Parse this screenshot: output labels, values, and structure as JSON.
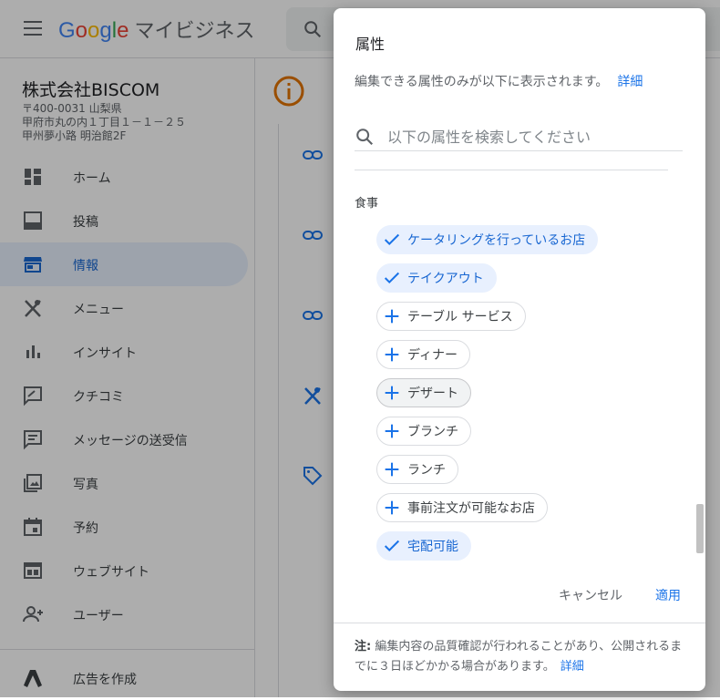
{
  "app": {
    "logo_google": "Google",
    "logo_product": "マイビジネス"
  },
  "business": {
    "name": "株式会社BISCOM",
    "address_line1": "〒400-0031 山梨県",
    "address_line2": "甲府市丸の内１丁目１－１－２５",
    "address_line3": "甲州夢小路 明治館2F"
  },
  "sidebar": {
    "items": [
      {
        "label": "ホーム",
        "icon": "dashboard-icon"
      },
      {
        "label": "投稿",
        "icon": "post-icon"
      },
      {
        "label": "情報",
        "icon": "storefront-icon",
        "active": true
      },
      {
        "label": "メニュー",
        "icon": "restaurant-icon"
      },
      {
        "label": "インサイト",
        "icon": "bar-chart-icon"
      },
      {
        "label": "クチコミ",
        "icon": "review-icon"
      },
      {
        "label": "メッセージの送受信",
        "icon": "message-icon"
      },
      {
        "label": "写真",
        "icon": "photo-icon"
      },
      {
        "label": "予約",
        "icon": "calendar-icon"
      },
      {
        "label": "ウェブサイト",
        "icon": "website-icon"
      },
      {
        "label": "ユーザー",
        "icon": "add-user-icon"
      }
    ],
    "ads_label": "広告を作成"
  },
  "dialog": {
    "title": "属性",
    "description": "編集できる属性のみが以下に表示されます。",
    "details_link": "詳細",
    "search_placeholder": "以下の属性を検索してください",
    "group_label": "食事",
    "chips": [
      {
        "label": "ケータリングを行っているお店",
        "selected": true
      },
      {
        "label": "テイクアウト",
        "selected": true
      },
      {
        "label": "テーブル サービス",
        "selected": false
      },
      {
        "label": "ディナー",
        "selected": false
      },
      {
        "label": "デザート",
        "selected": false
      },
      {
        "label": "ブランチ",
        "selected": false
      },
      {
        "label": "ランチ",
        "selected": false
      },
      {
        "label": "事前注文が可能なお店",
        "selected": false
      },
      {
        "label": "宅配可能",
        "selected": true
      }
    ],
    "cancel_label": "キャンセル",
    "apply_label": "適用",
    "note_prefix": "注:",
    "note_text": "編集内容の品質確認が行われることがあり、公開されるまでに３日ほどかかる場合があります。",
    "note_link": "詳細"
  },
  "colors": {
    "accent": "#1a73e8",
    "chip_selected_bg": "#e8f0fe",
    "scrim": "rgba(0,0,0,0.32)"
  }
}
